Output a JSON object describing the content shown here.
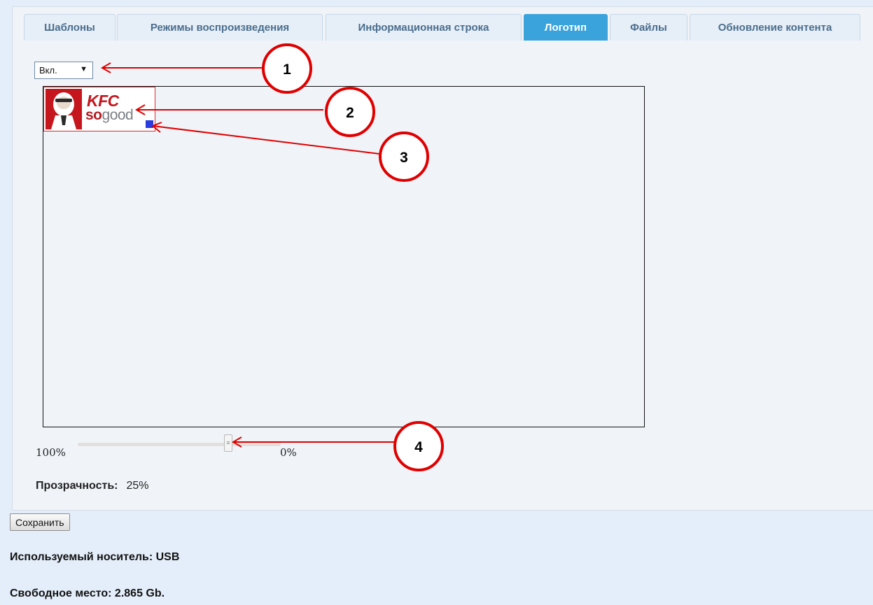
{
  "tabs": [
    {
      "label": "Шаблоны",
      "active": false
    },
    {
      "label": "Режимы воспроизведения",
      "active": false
    },
    {
      "label": "Информационная строка",
      "active": false
    },
    {
      "label": "Логотип",
      "active": true
    },
    {
      "label": "Файлы",
      "active": false
    },
    {
      "label": "Обновление контента",
      "active": false
    }
  ],
  "logo_toggle": {
    "selected": "Вкл."
  },
  "logo": {
    "line1": "KFC",
    "line2_so": "so",
    "line2_good": "good"
  },
  "slider": {
    "left_label": "100%",
    "right_label": "0%",
    "transparency_value": 25
  },
  "transparency": {
    "label": "Прозрачность:",
    "value": "25%"
  },
  "save_label": "Сохранить",
  "storage": {
    "media_text": "Используемый носитель: USB",
    "free_text": "Свободное место: 2.865 Gb."
  },
  "callouts": [
    "1",
    "2",
    "3",
    "4"
  ],
  "colors": {
    "active_tab": "#3aa3dc",
    "annotation": "#e00000",
    "resize_handle": "#2a3ce0",
    "logo_border": "#d63034"
  }
}
